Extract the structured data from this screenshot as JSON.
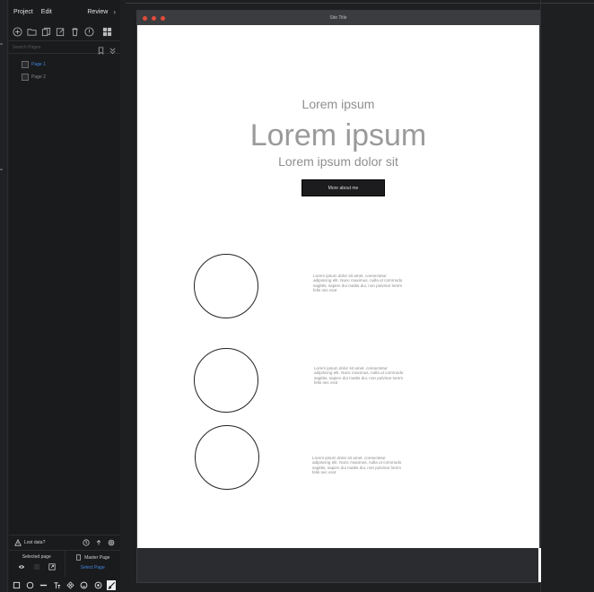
{
  "menu": {
    "project": "Project",
    "edit": "Edit",
    "review": "Review",
    "chevron": "›"
  },
  "toolbar": {
    "icons": [
      "add-page-icon",
      "folder-icon",
      "duplicate-icon",
      "edit-icon",
      "delete-icon",
      "info-icon",
      "grid-view-icon"
    ]
  },
  "search": {
    "placeholder": "Search Pages"
  },
  "pages": [
    {
      "label": "Page 1",
      "active": true
    },
    {
      "label": "Page 2",
      "active": false
    }
  ],
  "lost_data": {
    "label": "Lost data?"
  },
  "page_panel": {
    "selected_label": "Selected page",
    "master_label": "Master Page",
    "select_link": "Select Page"
  },
  "bottom_tools": [
    "rectangle-tool-icon",
    "ellipse-tool-icon",
    "line-tool-icon",
    "text-tool-icon",
    "component-tool-icon",
    "emoji-tool-icon",
    "target-tool-icon",
    "brush-tool-icon"
  ],
  "window": {
    "site_title": "Site Title"
  },
  "hero": {
    "small": "Lorem ipsum",
    "big": "Lorem ipsum",
    "sub": "Lorem ipsum dolor sit",
    "button": "More about me"
  },
  "features": [
    {
      "text": "Lorem ipsum dolor sit amet, consectetur adipiscing elit. Nunc maximus, nulla ut commodo sagittis, sapien dui mattis dui, non pulvinar lorem felis nec erat"
    },
    {
      "text": "Lorem ipsum dolor sit amet, consectetur adipiscing elit. Nunc maximus, nulla ut commodo sagittis, sapien dui mattis dui, non pulvinar lorem felis nec erat"
    },
    {
      "text": "Lorem ipsum dolor sit amet, consectetur adipiscing elit. Nunc maximus, nulla ut commodo sagittis, sapien dui mattis dui, non pulvinar lorem felis nec erat"
    }
  ],
  "colors": {
    "accent": "#3f86e0",
    "window_close": "#e24b3a",
    "sidebar_bg": "#1a1b1d",
    "footer_bg": "#2b2c2f"
  }
}
